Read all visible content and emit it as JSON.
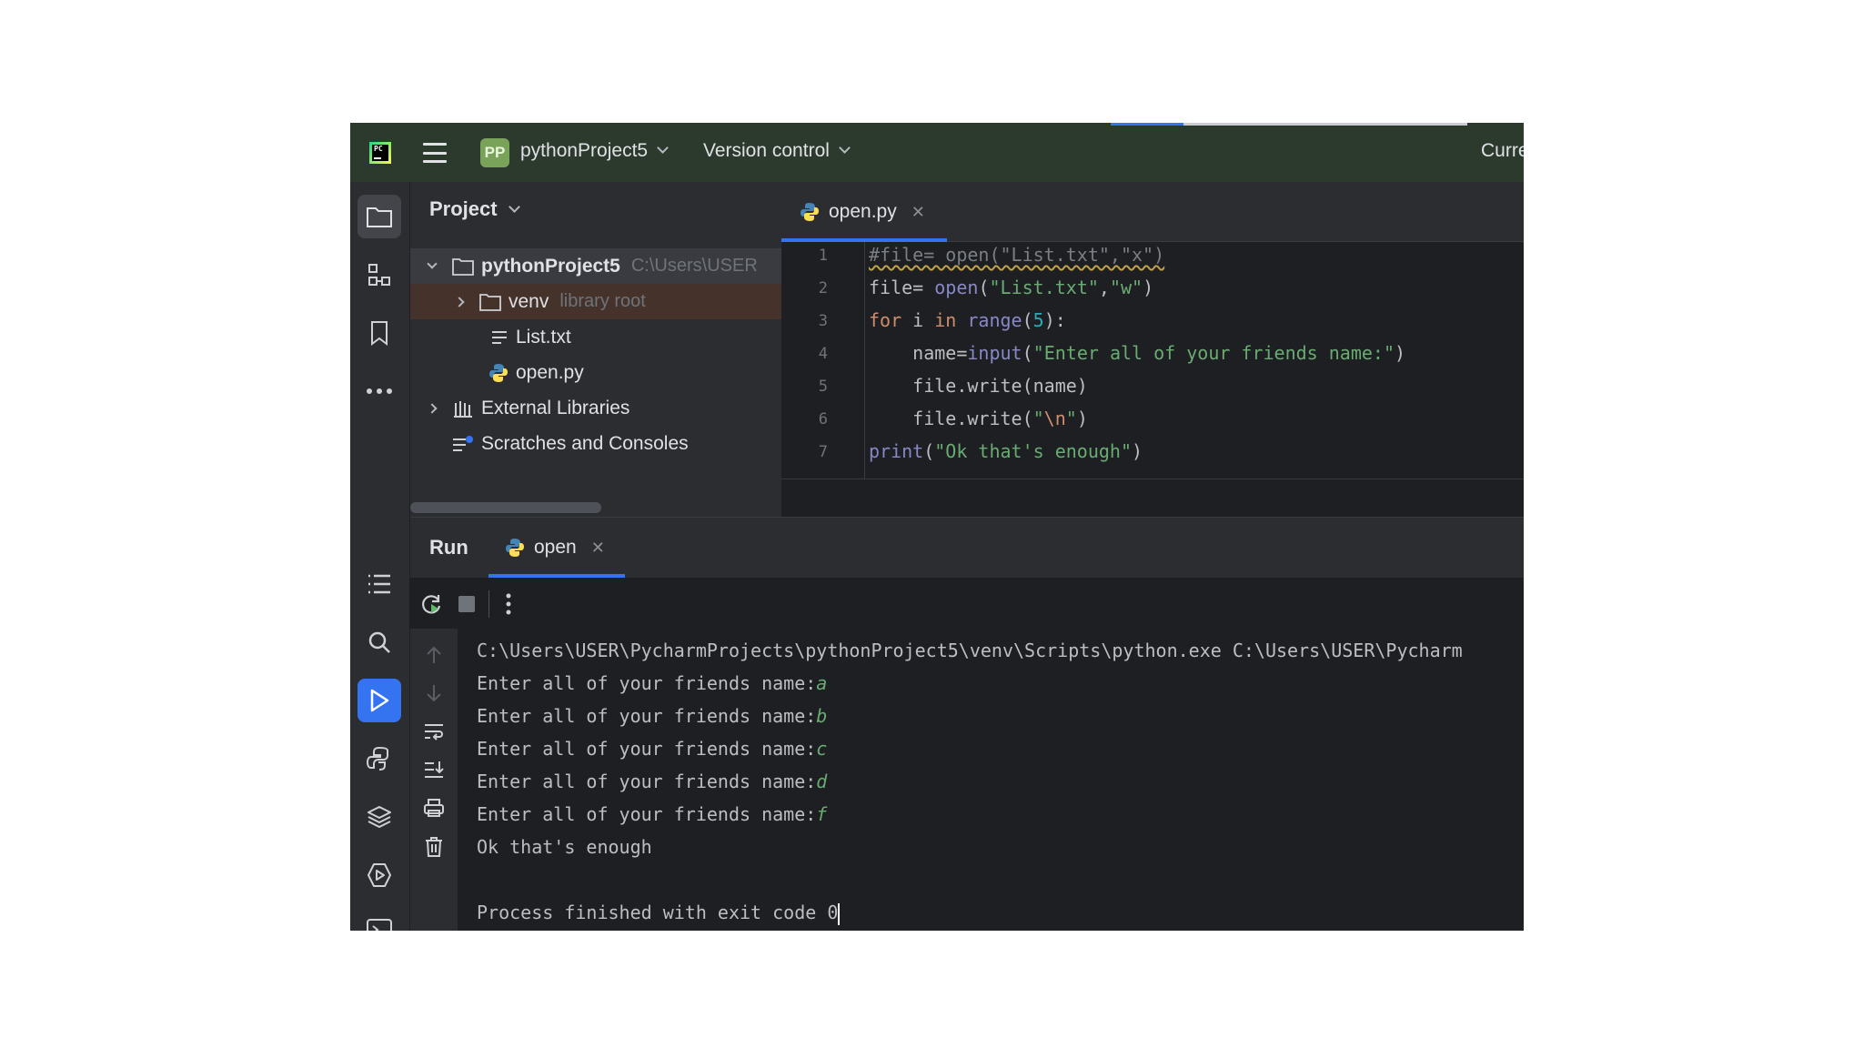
{
  "titlebar": {
    "project_badge": "PP",
    "project_name": "pythonProject5",
    "vcs_label": "Version control",
    "right_truncated": "Curre"
  },
  "project_panel": {
    "title": "Project",
    "tree": [
      {
        "label": "pythonProject5",
        "hint": "C:\\Users\\USER",
        "icon": "folder-icon",
        "expanded": true
      },
      {
        "label": "venv",
        "hint": "library root",
        "icon": "folder-icon",
        "expanded": false
      },
      {
        "label": "List.txt",
        "hint": "",
        "icon": "text-file-icon"
      },
      {
        "label": "open.py",
        "hint": "",
        "icon": "python-file-icon"
      },
      {
        "label": "External Libraries",
        "hint": "",
        "icon": "libraries-icon",
        "expanded": false
      },
      {
        "label": "Scratches and Consoles",
        "hint": "",
        "icon": "scratches-icon"
      }
    ]
  },
  "editor": {
    "tab_label": "open.py",
    "line_numbers": [
      "1",
      "2",
      "3",
      "4",
      "5",
      "6",
      "7"
    ],
    "code": {
      "l1": "#file= open(\"List.txt\",\"x\")",
      "l2_var": "file",
      "l2_eq": "= ",
      "l2_fn": "open",
      "l2_open": "(",
      "l2_arg1": "\"List.txt\"",
      "l2_comma": ",",
      "l2_arg2": "\"w\"",
      "l2_close": ")",
      "l3_for": "for",
      "l3_i": " i ",
      "l3_in": "in",
      "l3_sp": " ",
      "l3_range": "range",
      "l3_open": "(",
      "l3_num": "5",
      "l3_close": "):",
      "l4_indent": "    ",
      "l4_var": "name",
      "l4_eq": "=",
      "l4_fn": "input",
      "l4_open": "(",
      "l4_str": "\"Enter all of your friends name:\"",
      "l4_close": ")",
      "l5": "    file.write(name)",
      "l6_pre": "    file.write(",
      "l6_q1": "\"",
      "l6_esc": "\\n",
      "l6_q2": "\"",
      "l6_close": ")",
      "l7_fn": "print",
      "l7_open": "(",
      "l7_str": "\"Ok that's enough\"",
      "l7_close": ")"
    }
  },
  "run_panel": {
    "title": "Run",
    "tab_label": "open",
    "console": {
      "command": "C:\\Users\\USER\\PycharmProjects\\pythonProject5\\venv\\Scripts\\python.exe C:\\Users\\USER\\Pycharm",
      "prompt": "Enter all of your friends name:",
      "inputs": [
        "a",
        "b",
        "c",
        "d",
        "f"
      ],
      "final_message": "Ok that's enough",
      "exit_message": "Process finished with exit code 0"
    }
  },
  "colors": {
    "accent": "#3574f0",
    "titlebar_bg": "#2b3a2d",
    "panel_bg": "#2b2d30",
    "editor_bg": "#1e1f22",
    "keyword": "#cf8e6d",
    "string": "#6aab73",
    "number": "#2aacb8"
  }
}
